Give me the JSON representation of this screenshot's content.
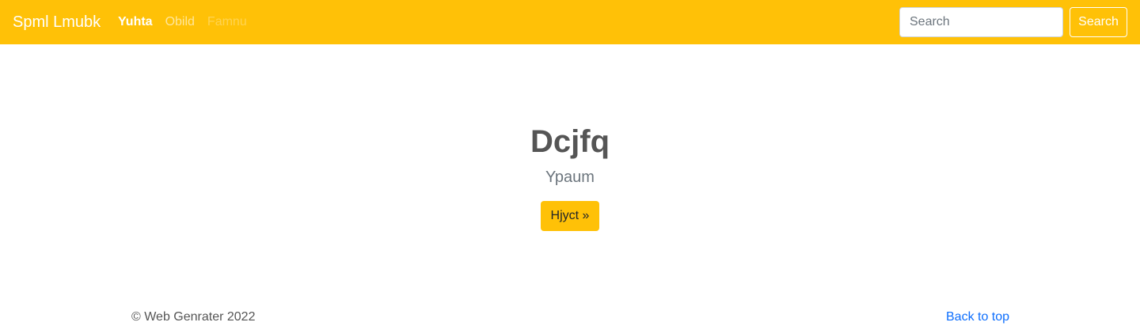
{
  "navbar": {
    "brand": "Spml Lmubk",
    "links": [
      {
        "label": "Yuhta",
        "state": "active"
      },
      {
        "label": "Obild",
        "state": "normal"
      },
      {
        "label": "Famnu",
        "state": "disabled"
      }
    ],
    "search": {
      "placeholder": "Search",
      "value": "",
      "button_label": "Search"
    }
  },
  "hero": {
    "title": "Dcjfq",
    "subtitle": "Ypaum",
    "button_label": "Hjyct »"
  },
  "footer": {
    "copyright": "© Web Genrater 2022",
    "back_to_top": "Back to top"
  },
  "colors": {
    "navbar_bg": "#ffc107",
    "button_bg": "#ffc107",
    "link": "#0d6efd",
    "text": "#555555"
  }
}
